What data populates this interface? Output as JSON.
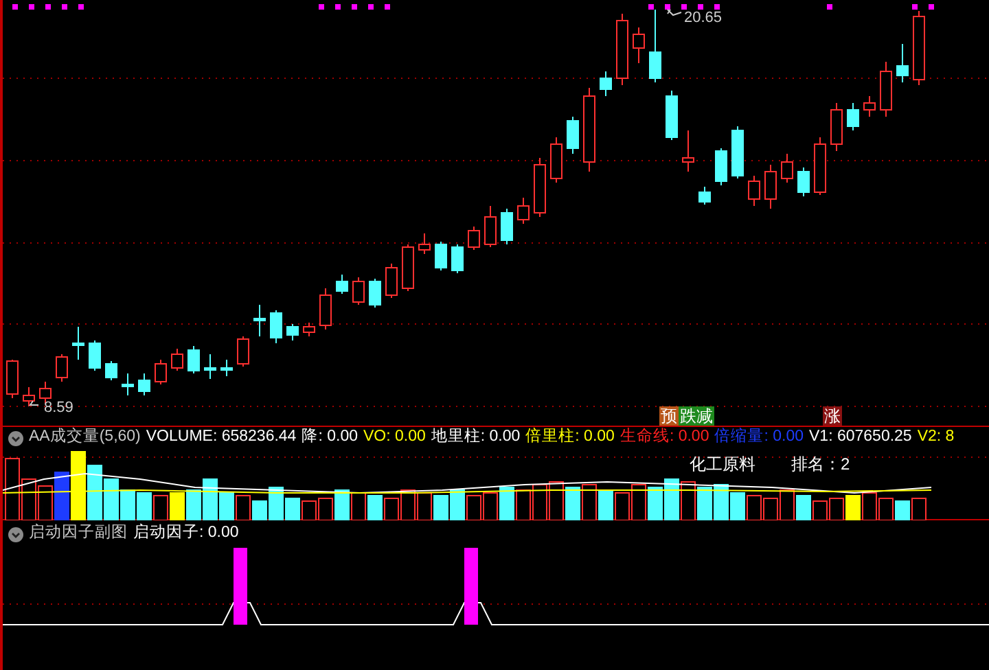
{
  "main_chart": {
    "high_label": "20.65",
    "low_label": "8.59",
    "signals": [
      {
        "parts": [
          {
            "text": "预",
            "color": "#b8561a"
          },
          {
            "text": "跌减",
            "color": "#1e8a1e"
          }
        ]
      },
      {
        "parts": [
          {
            "text": "涨",
            "color": "#8a1212"
          }
        ]
      }
    ]
  },
  "volume_pane": {
    "title": "AA成交量(5,60)",
    "fields": [
      {
        "text": "VOLUME: 658236.44",
        "color": "#ffffff"
      },
      {
        "text": "降: 0.00",
        "color": "#ffffff"
      },
      {
        "text": "VO: 0.00",
        "color": "#ffff00"
      },
      {
        "text": "地里柱: 0.00",
        "color": "#ffffff"
      },
      {
        "text": "倍里柱: 0.00",
        "color": "#ffff00"
      },
      {
        "text": "生命线: 0.00",
        "color": "#ff2020"
      },
      {
        "text": "倍缩量: 0.00",
        "color": "#1e3cff"
      },
      {
        "text": "V1: 607650.25",
        "color": "#ffffff"
      },
      {
        "text": "V2: 8",
        "color": "#ffff00"
      }
    ],
    "sector": "化工原料",
    "rank": "排名：2"
  },
  "factor_pane": {
    "title": "启动因子副图",
    "fields": [
      {
        "text": "启动因子: 0.00",
        "color": "#ffffff"
      }
    ]
  }
}
